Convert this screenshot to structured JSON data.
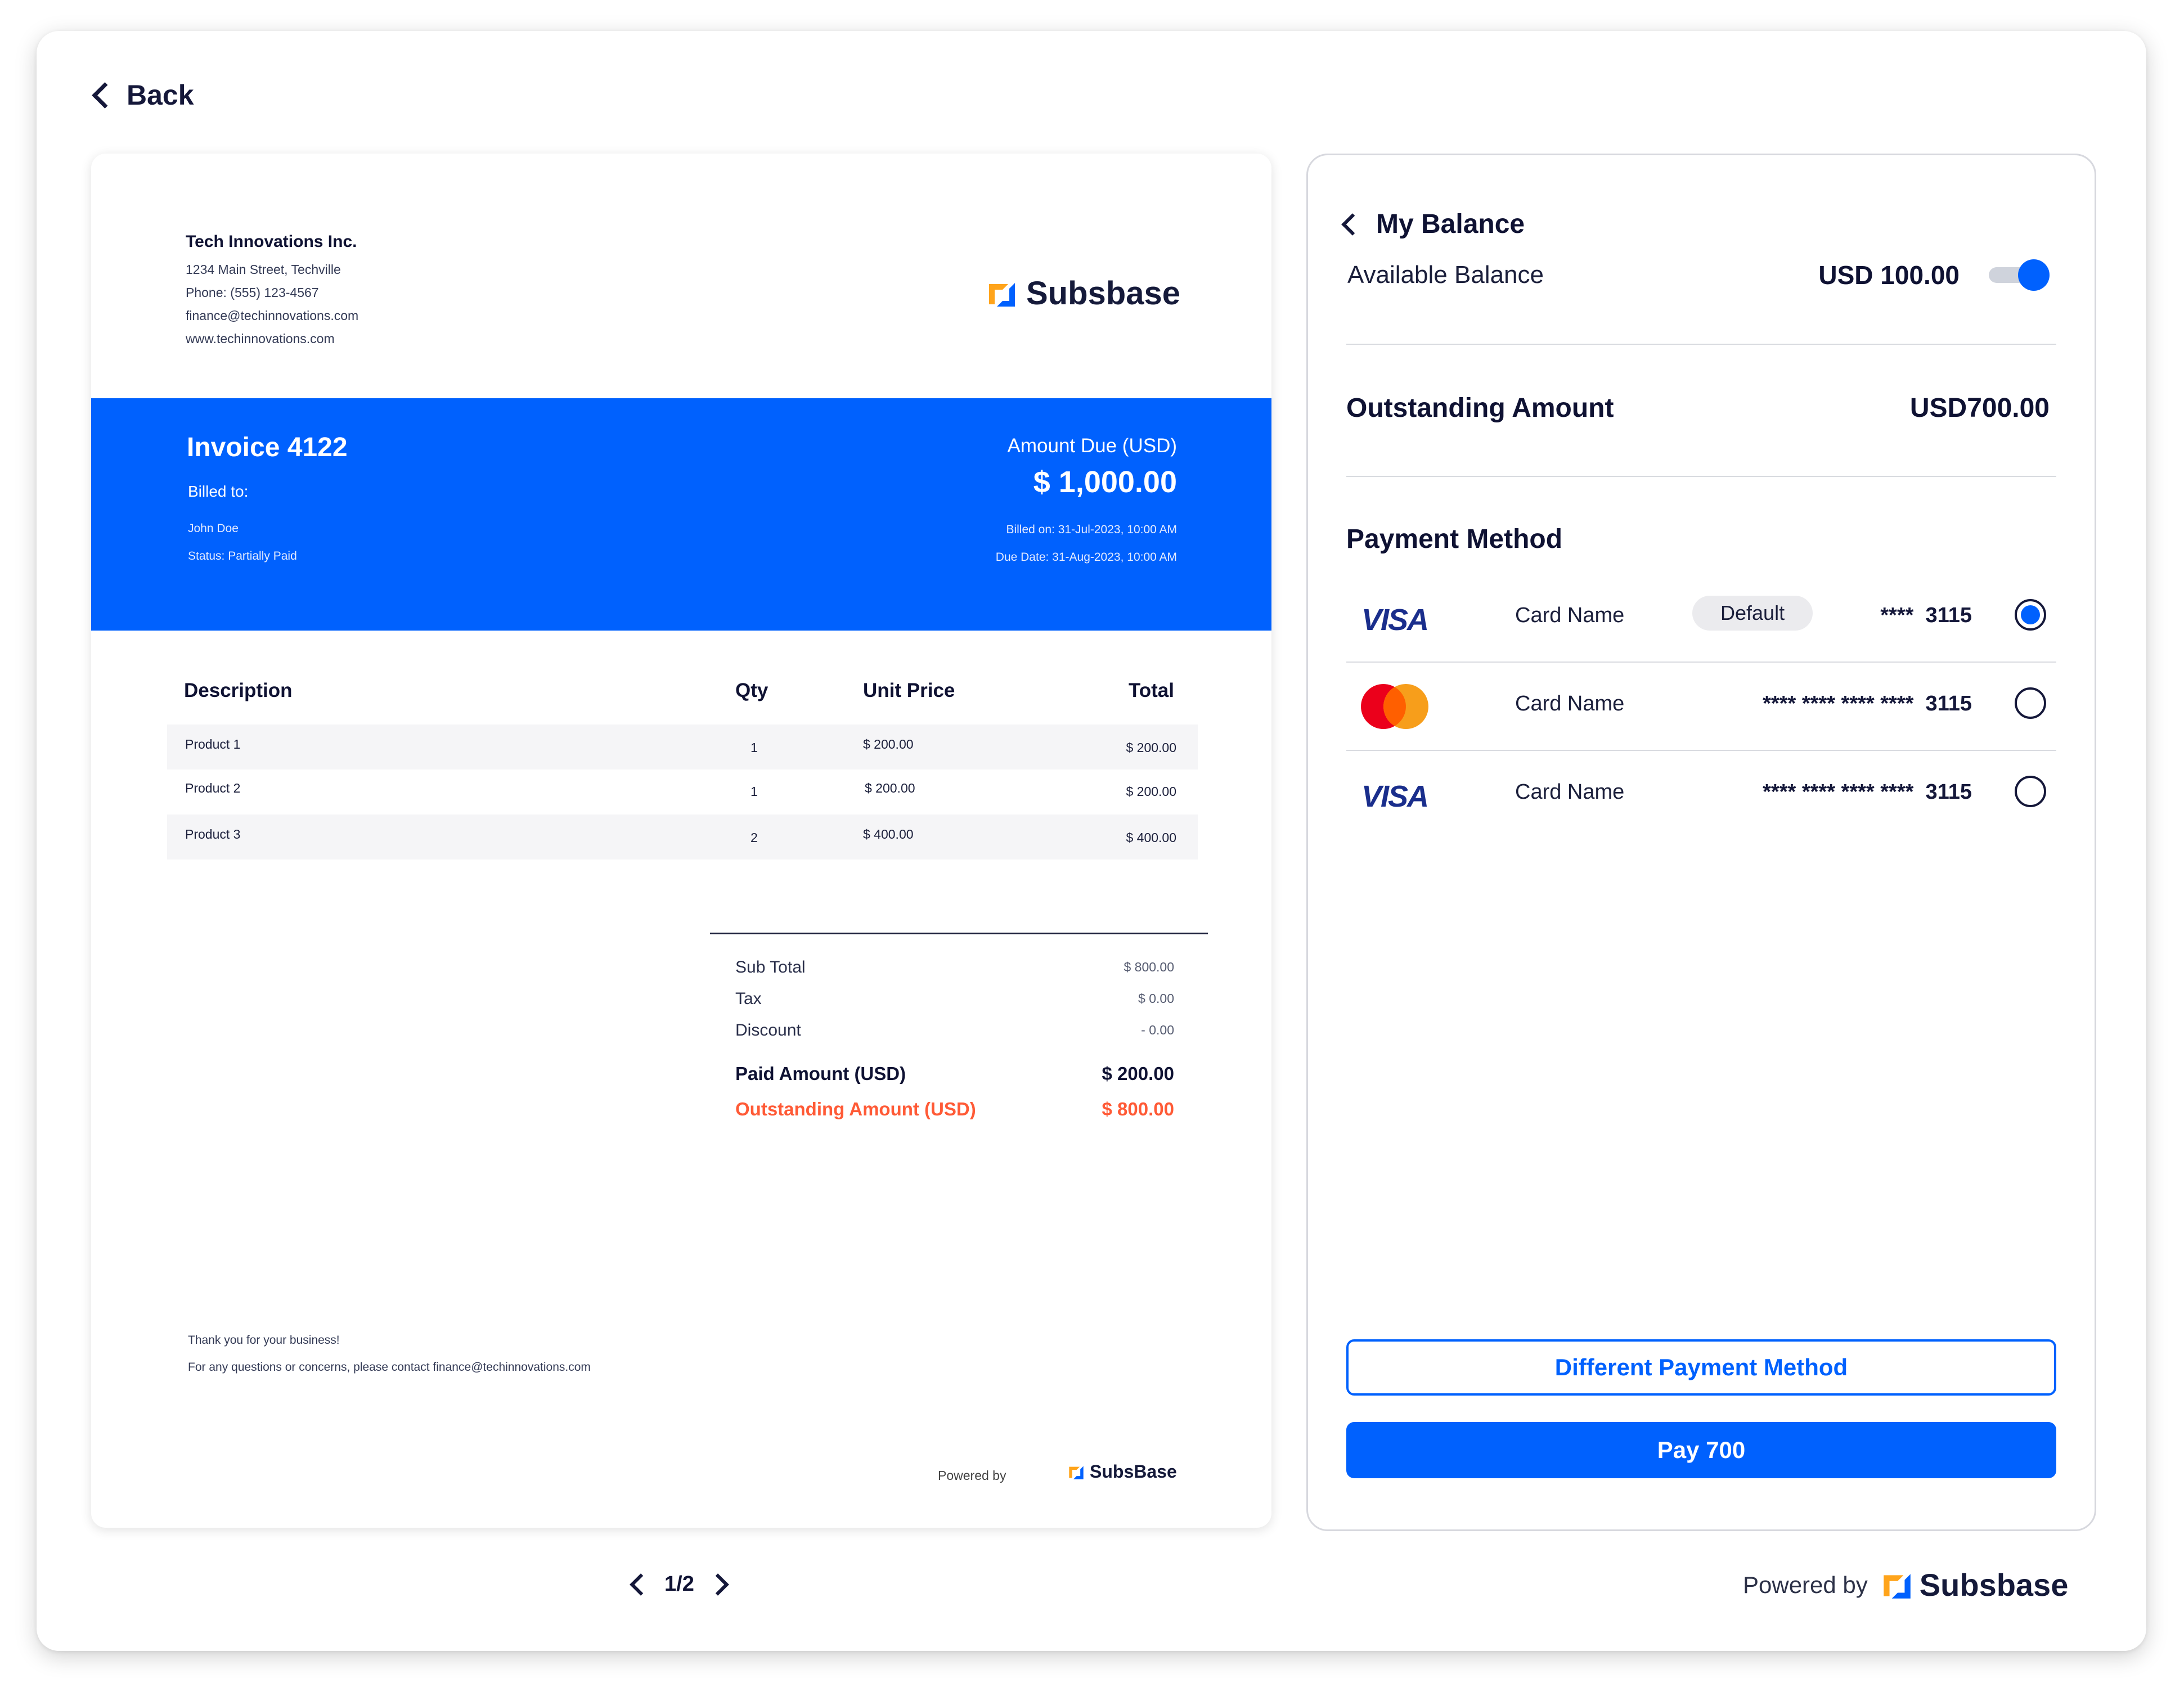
{
  "nav": {
    "back_label": "Back"
  },
  "company": {
    "name": "Tech Innovations Inc.",
    "address": "1234 Main Street, Techville",
    "phone": "Phone: (555) 123-4567",
    "email": "finance@techinnovations.com",
    "website": "www.techinnovations.com"
  },
  "brand": {
    "name": "Subsbase",
    "small_name": "SubsBase",
    "powered_by": "Powered by"
  },
  "invoice": {
    "title": "Invoice 4122",
    "billed_to_label": "Billed to:",
    "customer": "John Doe",
    "status": "Status: Partially Paid",
    "amount_due_label": "Amount Due (USD)",
    "amount_due": "$ 1,000.00",
    "billed_on": "Billed on: 31-Jul-2023, 10:00 AM",
    "due_date": "Due Date: 31-Aug-2023, 10:00 AM"
  },
  "table": {
    "headers": [
      "Description",
      "Qty",
      "Unit Price",
      "Total"
    ],
    "rows": [
      {
        "desc": "Product 1",
        "qty": "1",
        "unit": "$ 200.00",
        "total": "$ 200.00"
      },
      {
        "desc": "Product 2",
        "qty": "1",
        "unit": "$ 200.00",
        "total": "$ 200.00"
      },
      {
        "desc": "Product 3",
        "qty": "2",
        "unit": "$ 400.00",
        "total": "$ 400.00"
      }
    ]
  },
  "totals": {
    "subtotal_label": "Sub Total",
    "subtotal": "$ 800.00",
    "tax_label": "Tax",
    "tax": "$ 0.00",
    "discount_label": "Discount",
    "discount": "- 0.00",
    "paid_label": "Paid Amount (USD)",
    "paid": "$ 200.00",
    "outstanding_label": "Outstanding Amount (USD)",
    "outstanding": "$ 800.00"
  },
  "footer": {
    "thanks": "Thank you for your business!",
    "contact": "For any questions or concerns, please contact finance@techinnovations.com"
  },
  "pager": {
    "label": "1/2"
  },
  "balance": {
    "title": "My Balance",
    "available_label": "Available Balance",
    "available_value": "USD 100.00",
    "toggle_on": true,
    "outstanding_label": "Outstanding Amount",
    "outstanding_value": "USD700.00"
  },
  "payment": {
    "title": "Payment Method",
    "methods": [
      {
        "brand": "VISA",
        "name": "Card Name",
        "badge": "Default",
        "masked": "****",
        "last4": "3115",
        "selected": true
      },
      {
        "brand": "mastercard",
        "name": "Card Name",
        "badge": "",
        "masked": "**** **** **** ****",
        "last4": "3115",
        "selected": false
      },
      {
        "brand": "VISA",
        "name": "Card Name",
        "badge": "",
        "masked": "**** **** **** ****",
        "last4": "3115",
        "selected": false
      }
    ],
    "different_label": "Different Payment Method",
    "pay_label": "Pay 700"
  },
  "colors": {
    "accent": "#0061fe",
    "danger": "#ff5a36",
    "text": "#0f1233"
  }
}
